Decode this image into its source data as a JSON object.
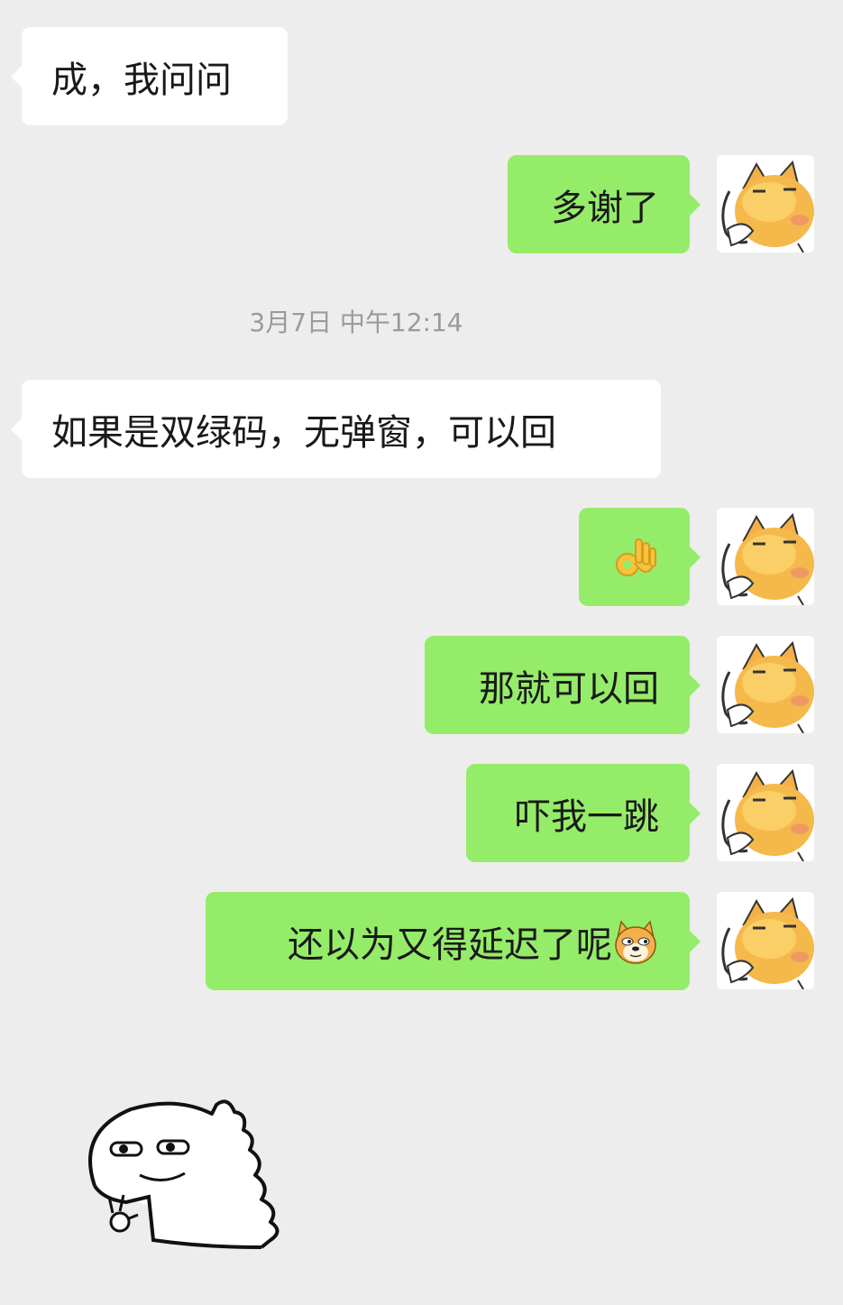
{
  "messages": [
    {
      "text": "成，我问问"
    },
    {
      "text": "多谢了"
    },
    {
      "text": "如果是双绿码，无弹窗，可以回"
    },
    {
      "emoji": "ok-hand-emoji"
    },
    {
      "text": "那就可以回"
    },
    {
      "text": "吓我一跳"
    },
    {
      "text": "还以为又得延迟了呢",
      "emoji": "doge-emoji"
    }
  ],
  "timestamp": "3月7日 中午12:14",
  "colors": {
    "background": "#ededed",
    "incoming_bubble": "#ffffff",
    "outgoing_bubble": "#95ec69",
    "text": "#191919",
    "timestamp": "#9a9a9a"
  },
  "icons": {
    "avatar": "cat-avatar",
    "sticker": "dinosaur-sticker"
  }
}
